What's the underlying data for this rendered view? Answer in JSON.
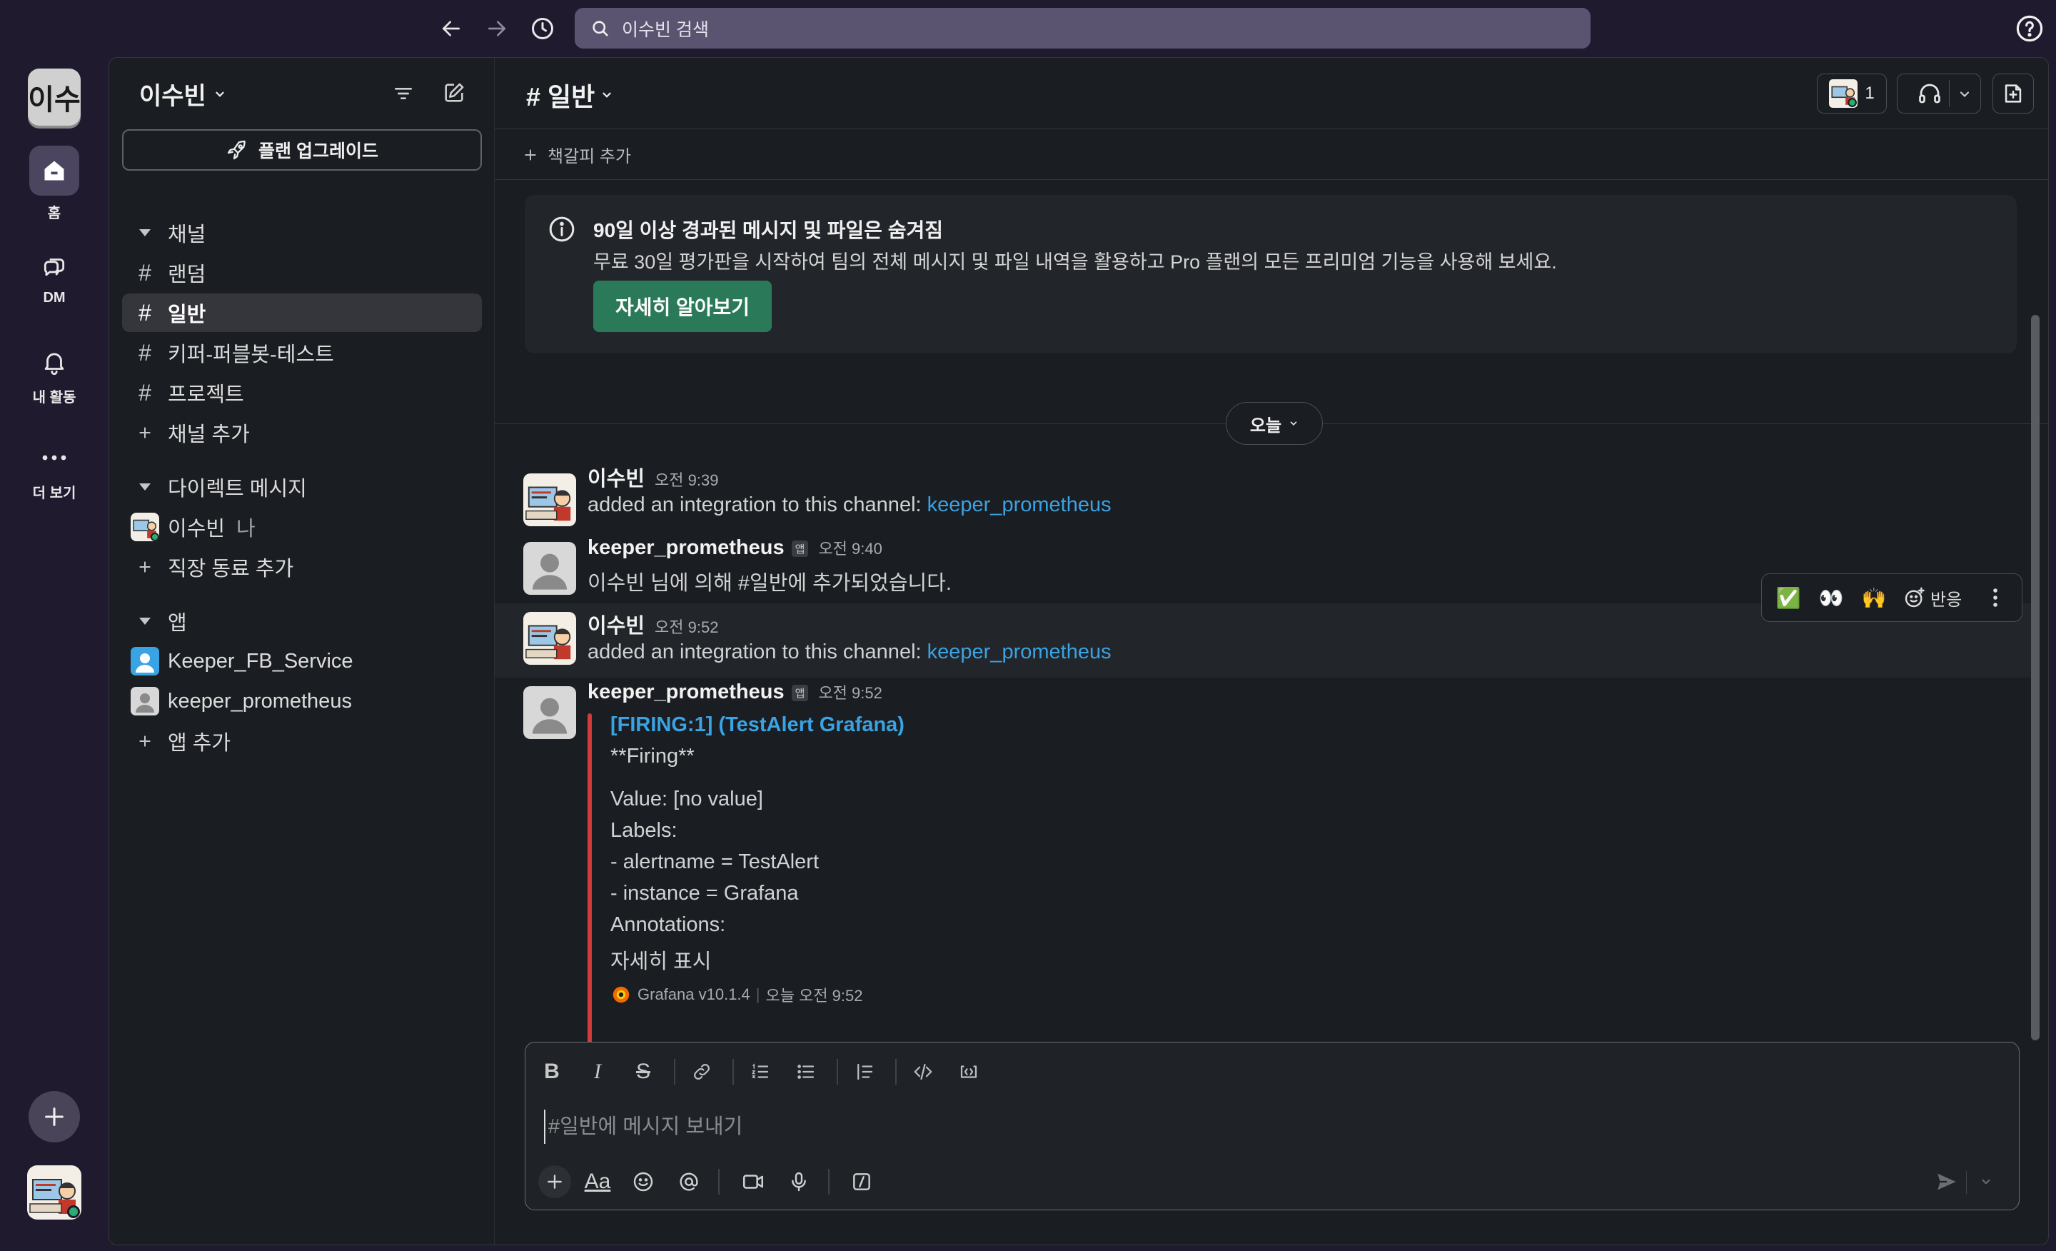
{
  "topbar": {
    "search_placeholder": "이수빈 검색",
    "back": "back-arrow",
    "forward": "forward-arrow",
    "history": "history-icon",
    "help": "help-icon"
  },
  "rail": {
    "workspace_abbr": "이수",
    "items": [
      {
        "label": "홈",
        "icon": "home-icon"
      },
      {
        "label": "DM",
        "icon": "dm-icon"
      },
      {
        "label": "내 활동",
        "icon": "bell-icon"
      },
      {
        "label": "더 보기",
        "icon": "more-icon"
      }
    ]
  },
  "sidebar": {
    "workspace_name": "이수빈",
    "upgrade_label": "플랜 업그레이드",
    "sections": {
      "channels_header": "채널",
      "channels": [
        "랜덤",
        "일반",
        "키퍼-퍼블봇-테스트",
        "프로젝트"
      ],
      "active_channel": "일반",
      "add_channel": "채널 추가",
      "dm_header": "다이렉트 메시지",
      "dm_user": "이수빈",
      "dm_me": "나",
      "add_coworker": "직장 동료 추가",
      "apps_header": "앱",
      "apps": [
        "Keeper_FB_Service",
        "keeper_prometheus"
      ],
      "add_app": "앱 추가"
    }
  },
  "channel": {
    "title": "# 일반",
    "members_count": "1",
    "bookmark_add": "책갈피 추가"
  },
  "banner": {
    "title": "90일 이상 경과된 메시지 및 파일은 숨겨짐",
    "body": "무료 30일 평가판을 시작하여 팀의 전체 메시지 및 파일 내역을 활용하고 Pro 플랜의 모든 프리미엄 기능을 사용해 보세요.",
    "button": "자세히 알아보기"
  },
  "date_divider": "오늘",
  "messages": [
    {
      "author": "이수빈",
      "time": "오전 9:39",
      "text_prefix": "added an integration to this channel: ",
      "link": "keeper_prometheus"
    },
    {
      "author": "keeper_prometheus",
      "badge": "앱",
      "time": "오전 9:40",
      "text": "이수빈 님에 의해 #일반에 추가되었습니다."
    },
    {
      "author": "이수빈",
      "time": "오전 9:52",
      "text_prefix": "added an integration to this channel: ",
      "link": "keeper_prometheus"
    },
    {
      "author": "keeper_prometheus",
      "badge": "앱",
      "time": "오전 9:52"
    }
  ],
  "attachment": {
    "title": "[FIRING:1]  (TestAlert Grafana)",
    "lines": [
      "**Firing**",
      "Value: [no value]",
      "Labels:",
      "- alertname = TestAlert",
      "- instance = Grafana",
      "Annotations:"
    ],
    "show_more": "자세히 표시",
    "footer_source": "Grafana v10.1.4",
    "footer_time": "오늘 오전 9:52"
  },
  "reaction_bar": {
    "react_label": "반응",
    "emojis": [
      "✅",
      "👀",
      "🙌"
    ]
  },
  "composer": {
    "placeholder": "#일반에 메시지 보내기"
  },
  "colors": {
    "accent_green": "#2a7a5a",
    "link_blue": "#3aa3e3",
    "alert_red": "#d23b3b"
  }
}
